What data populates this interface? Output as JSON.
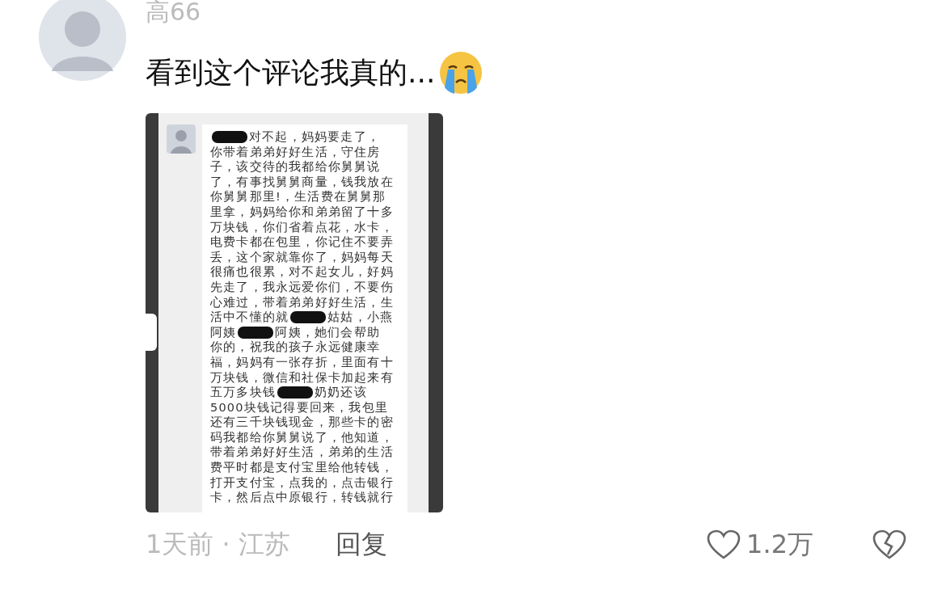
{
  "comment": {
    "author": "高66",
    "text": "看到这个评论我真的...",
    "time_location": "1天前 · 江苏",
    "reply": "回复",
    "likes": "1.2万"
  },
  "attachment": {
    "kind": "chat_screenshot",
    "lines": [
      [
        {
          "kind": "redacted"
        },
        {
          "kind": "text",
          "text": "对不起，妈妈要走了，"
        }
      ],
      [
        {
          "kind": "text",
          "text": "你带着弟弟好好生活，守住房"
        }
      ],
      [
        {
          "kind": "text",
          "text": "子，该交待的我都给你舅舅说"
        }
      ],
      [
        {
          "kind": "text",
          "text": "了，有事找舅舅商量，钱我放在"
        }
      ],
      [
        {
          "kind": "text",
          "text": "你舅舅那里!，生活费在舅舅那"
        }
      ],
      [
        {
          "kind": "text",
          "text": "里拿，妈妈给你和弟弟留了十多"
        }
      ],
      [
        {
          "kind": "text",
          "text": "万块钱，你们省着点花，水卡，"
        }
      ],
      [
        {
          "kind": "text",
          "text": "电费卡都在包里，你记住不要弄"
        }
      ],
      [
        {
          "kind": "text",
          "text": "丢，这个家就靠你了，妈妈每天"
        }
      ],
      [
        {
          "kind": "text",
          "text": "很痛也很累，对不起女儿，好妈"
        }
      ],
      [
        {
          "kind": "text",
          "text": "先走了，我永远爱你们，不要伤"
        }
      ],
      [
        {
          "kind": "text",
          "text": "心难过，带着弟弟好好生活，生"
        }
      ],
      [
        {
          "kind": "text",
          "text": "活中不懂的就"
        },
        {
          "kind": "redacted"
        },
        {
          "kind": "text",
          "text": "姑姑，小燕"
        }
      ],
      [
        {
          "kind": "text",
          "text": "阿姨"
        },
        {
          "kind": "redacted"
        },
        {
          "kind": "text",
          "text": "阿姨，她们会帮助"
        }
      ],
      [
        {
          "kind": "text",
          "text": "你的，祝我的孩子永远健康幸"
        }
      ],
      [
        {
          "kind": "text",
          "text": "福，妈妈有一张存折，里面有十"
        }
      ],
      [
        {
          "kind": "text",
          "text": "万块钱，微信和社保卡加起来有"
        }
      ],
      [
        {
          "kind": "text",
          "text": "五万多块钱"
        },
        {
          "kind": "redacted"
        },
        {
          "kind": "text",
          "text": "奶奶还该"
        }
      ],
      [
        {
          "kind": "text",
          "text": "5000块钱记得要回来，我包里"
        }
      ],
      [
        {
          "kind": "text",
          "text": "还有三千块钱现金，那些卡的密"
        }
      ],
      [
        {
          "kind": "text",
          "text": "码我都给你舅舅说了，他知道，"
        }
      ],
      [
        {
          "kind": "text",
          "text": "带着弟弟好好生活，弟弟的生活"
        }
      ],
      [
        {
          "kind": "text",
          "text": "费平时都是支付宝里给他转钱，"
        }
      ],
      [
        {
          "kind": "text",
          "text": "打开支付宝，点我的，点击银行"
        }
      ],
      [
        {
          "kind": "text",
          "text": "卡，然后点中原银行，转钱就行"
        }
      ]
    ]
  }
}
